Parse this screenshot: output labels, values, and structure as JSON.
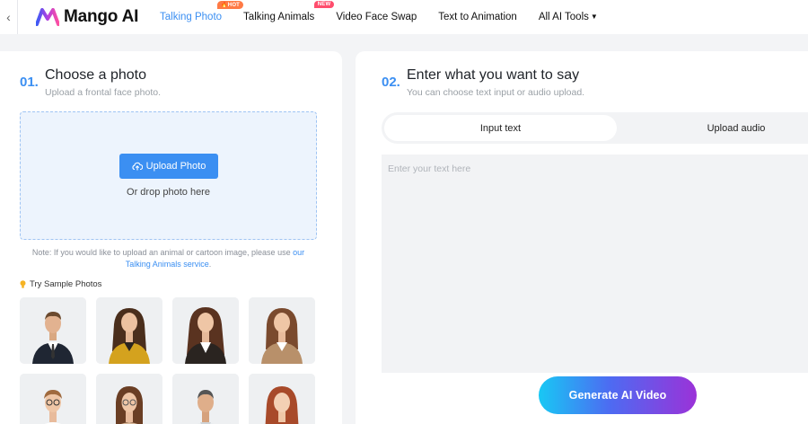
{
  "header": {
    "back_icon": "chevron-left-icon",
    "brand": "Mango AI",
    "nav": [
      {
        "label": "Talking Photo",
        "badge": "HOT",
        "active": true
      },
      {
        "label": "Talking Animals",
        "badge": "NEW",
        "active": false
      },
      {
        "label": "Video Face Swap",
        "active": false
      },
      {
        "label": "Text to Animation",
        "active": false
      },
      {
        "label": "All AI Tools",
        "active": false
      }
    ]
  },
  "step1": {
    "number": "01.",
    "title": "Choose a photo",
    "subtitle": "Upload a frontal face photo.",
    "upload_button": "Upload Photo",
    "drop_hint": "Or drop photo here",
    "note_prefix": "Note: If you would like to upload an animal or cartoon image, please use ",
    "note_link": "our Talking Animals service",
    "note_suffix": ".",
    "samples_label": "Try Sample Photos"
  },
  "step2": {
    "number": "02.",
    "title": "Enter what you want to say",
    "subtitle": "You can choose text input or audio upload.",
    "tabs": [
      "Input text",
      "Upload audio"
    ],
    "text_placeholder": "Enter your text here",
    "generate_button": "Generate AI Video"
  },
  "colors": {
    "accent": "#3b8ff2",
    "hot_badge": "#ff7a45",
    "new_badge": "#ff4d6d",
    "generate_gradient": [
      "#18c8f4",
      "#4d6bf2",
      "#9b32d8"
    ]
  }
}
